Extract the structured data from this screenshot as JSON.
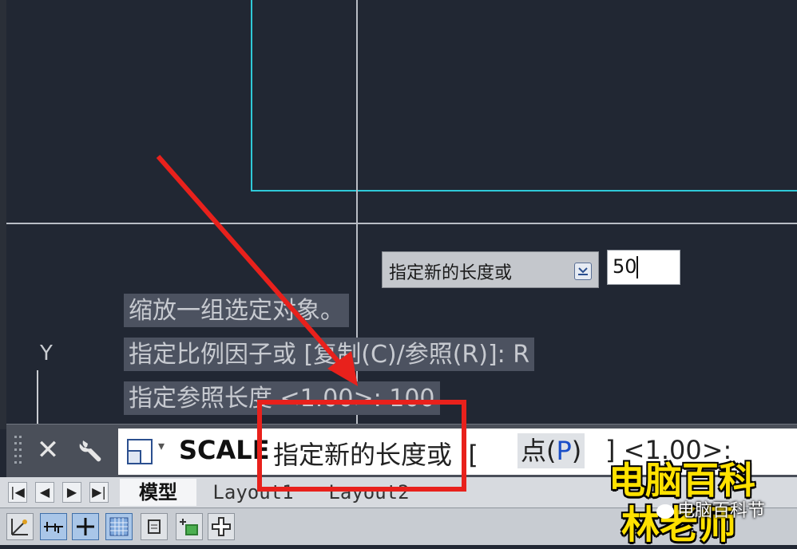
{
  "history": {
    "line1": "缩放一组选定对象。",
    "line2": "指定比例因子或 [复制(C)/参照(R)]: R",
    "line3": "指定参照长度 <1.00>: 100"
  },
  "tooltip": {
    "label": "指定新的长度或",
    "dropdown_icon": "arrow-down-icon"
  },
  "dynamic_input": {
    "value": "50"
  },
  "ucs": {
    "y_label": "Y"
  },
  "command_line": {
    "close_icon": "close-icon",
    "customize_icon": "wrench-icon",
    "command_icon": "scale-command-icon",
    "command_name": "SCALE",
    "prompt": "指定新的长度或",
    "bracket_open": "[",
    "option_label": "点(",
    "option_key": "P",
    "option_close": ")",
    "tail": "] <1.00>:"
  },
  "tabs": {
    "nav": [
      "|◀",
      "◀",
      "▶",
      "▶|"
    ],
    "items": [
      "模型",
      "Layout1",
      "Layout2"
    ],
    "active": "模型"
  },
  "status_buttons": [
    {
      "name": "ucs-icon",
      "on": false
    },
    {
      "name": "snap-icon",
      "on": true
    },
    {
      "name": "ortho-icon",
      "on": true
    },
    {
      "name": "grid-icon",
      "on": true
    },
    {
      "name": "model-space-icon",
      "on": false
    },
    {
      "name": "object-snap-icon",
      "on": false
    },
    {
      "name": "dynamic-input-icon",
      "on": false
    }
  ],
  "watermark": {
    "line1": "电脑百科",
    "line2": "林老师",
    "account": "电脑百科节"
  },
  "colors": {
    "canvas": "#212733",
    "rectangle": "#2fc9d8",
    "annotation": "#e8211c",
    "watermark": "#ffe100"
  }
}
